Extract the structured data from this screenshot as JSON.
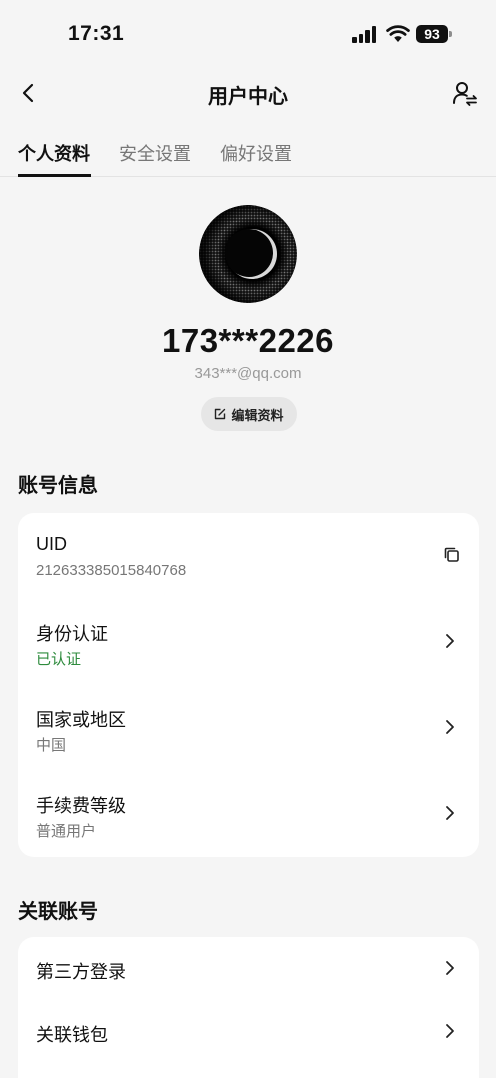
{
  "status_bar": {
    "time": "17:31",
    "battery": "93"
  },
  "nav": {
    "title": "用户中心"
  },
  "tabs": [
    {
      "label": "个人资料",
      "active": true
    },
    {
      "label": "安全设置",
      "active": false
    },
    {
      "label": "偏好设置",
      "active": false
    }
  ],
  "profile": {
    "username": "173***2226",
    "email": "343***@qq.com",
    "edit_label": "编辑资料"
  },
  "account_info": {
    "title": "账号信息",
    "uid_label": "UID",
    "uid_value": "212633385015840768",
    "identity_label": "身份认证",
    "identity_value": "已认证",
    "region_label": "国家或地区",
    "region_value": "中国",
    "fee_label": "手续费等级",
    "fee_value": "普通用户"
  },
  "linked": {
    "title": "关联账号",
    "third_party_label": "第三方登录",
    "wallet_label": "关联钱包"
  },
  "colors": {
    "verified": "#2e8b3d",
    "background": "#f5f5f5"
  }
}
